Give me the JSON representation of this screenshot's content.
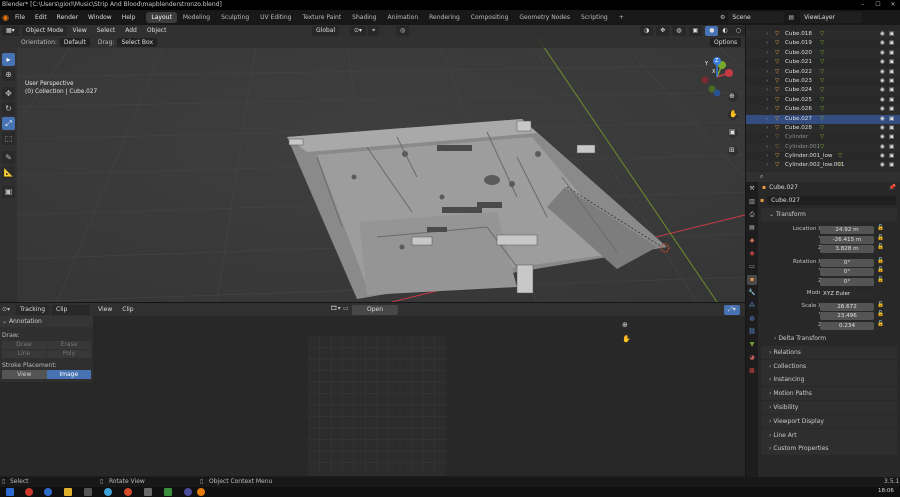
{
  "window": {
    "title": "Blender* [C:\\Users\\giorl\\Music\\Strip And Blood\\mapblenderstronzo.blend]"
  },
  "menu": [
    "File",
    "Edit",
    "Render",
    "Window",
    "Help"
  ],
  "workspaces": [
    "Layout",
    "Modeling",
    "Sculpting",
    "UV Editing",
    "Texture Paint",
    "Shading",
    "Animation",
    "Rendering",
    "Compositing",
    "Geometry Nodes",
    "Scripting"
  ],
  "workspace_add": "+",
  "scene": {
    "scene_label": "Scene",
    "viewlayer_label": "ViewLayer"
  },
  "viewport_header": {
    "mode": "Object Mode",
    "view": "View",
    "select": "Select",
    "add": "Add",
    "object": "Object",
    "transform": "Global",
    "options": "Options"
  },
  "tool_header": {
    "orientation_label": "Orientation:",
    "orientation_value": "Default",
    "drag_label": "Drag:",
    "drag_value": "Select Box"
  },
  "viewport_overlay": {
    "line1": "User Perspective",
    "line2": "(0) Collection | Cube.027"
  },
  "gizmo": {
    "x": "X",
    "y": "Y",
    "z": "Z"
  },
  "clip_header": {
    "tracking": "Tracking",
    "clip": "Clip",
    "view": "View",
    "clip_menu": "Clip",
    "open": "Open"
  },
  "annotation": {
    "panel_title": "Annotation",
    "draw_label": "Draw:",
    "draw_tools": [
      "Draw",
      "Erase",
      "Line",
      "Poly"
    ],
    "placement_label": "Stroke Placement:",
    "placement_options": [
      "View",
      "Image"
    ],
    "placement_selected": "Image"
  },
  "outliner": {
    "items": [
      {
        "name": "Cube.018",
        "dim": false
      },
      {
        "name": "Cube.019",
        "dim": false
      },
      {
        "name": "Cube.020",
        "dim": false
      },
      {
        "name": "Cube.021",
        "dim": false
      },
      {
        "name": "Cube.022",
        "dim": false
      },
      {
        "name": "Cube.023",
        "dim": false
      },
      {
        "name": "Cube.024",
        "dim": false
      },
      {
        "name": "Cube.025",
        "dim": false
      },
      {
        "name": "Cube.026",
        "dim": false
      },
      {
        "name": "Cube.027",
        "dim": false,
        "selected": true
      },
      {
        "name": "Cube.028",
        "dim": false
      },
      {
        "name": "Cylinder",
        "dim": true
      },
      {
        "name": "Cylinder.001",
        "dim": true
      },
      {
        "name": "Cylinder.001_low",
        "dim": false
      },
      {
        "name": "Cylinder.002_low.001",
        "dim": false
      }
    ]
  },
  "properties": {
    "object_header": "Cube.027",
    "object_name": "Cube.027",
    "transform_title": "Transform",
    "location": {
      "label": "Location X",
      "x": "24.92 m",
      "y": "-26.415 m",
      "z": "3.828 m"
    },
    "rotation": {
      "label": "Rotation X",
      "x": "0°",
      "y": "0°",
      "z": "0°"
    },
    "mode": {
      "label": "Mode",
      "value": "XYZ Euler"
    },
    "scale": {
      "label": "Scale X",
      "x": "26.672",
      "y": "23.496",
      "z": "0.234"
    },
    "axis_y": "Y",
    "axis_z": "Z",
    "delta_transform": "Delta Transform",
    "sections": [
      "Relations",
      "Collections",
      "Instancing",
      "Motion Paths",
      "Visibility",
      "Viewport Display",
      "Line Art",
      "Custom Properties"
    ]
  },
  "statusbar": {
    "select": "Select",
    "rotate": "Rotate View",
    "context": "Object Context Menu",
    "version": "3.5.1"
  },
  "taskbar": {
    "time": "18:06"
  },
  "colors": {
    "accent": "#4772b3",
    "x_axis": "#c73a45",
    "y_axis": "#79a92c",
    "z_axis": "#3a7de0",
    "selected_row": "#334d80"
  }
}
